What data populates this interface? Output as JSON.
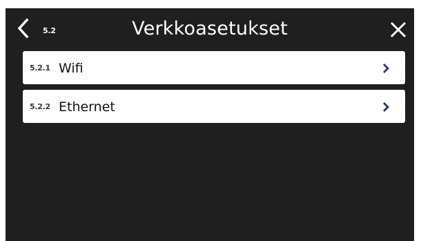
{
  "header": {
    "back_label": "5.2",
    "title": "Verkkoasetukset"
  },
  "menu": {
    "items": [
      {
        "number": "5.2.1",
        "label": "Wifi"
      },
      {
        "number": "5.2.2",
        "label": "Ethernet"
      }
    ]
  },
  "colors": {
    "background": "#1f1f1f",
    "item_background": "#ffffff",
    "chevron": "#1f3a5f"
  },
  "icons": {
    "back": "chevron-left-icon",
    "close": "close-icon",
    "item_arrow": "chevron-right-icon"
  }
}
